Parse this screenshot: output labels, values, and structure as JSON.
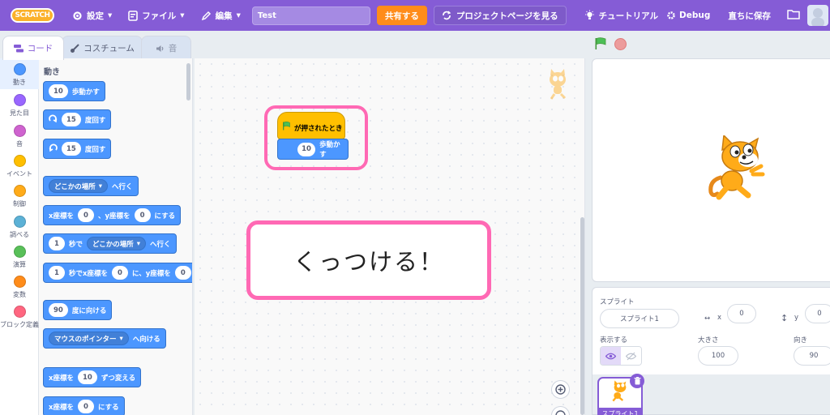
{
  "menubar": {
    "logo": "SCRATCH",
    "settings": "設定",
    "file": "ファイル",
    "edit": "編集",
    "project_title": "Test",
    "share": "共有する",
    "project_page": "プロジェクトページを見る",
    "tutorials": "チュートリアル",
    "debug": "Debug",
    "save_now": "直ちに保存"
  },
  "tabs": {
    "code": "コード",
    "costume": "コスチューム",
    "sound": "音"
  },
  "categories": [
    {
      "label": "動き",
      "color": "#4c97ff"
    },
    {
      "label": "見た目",
      "color": "#9966ff"
    },
    {
      "label": "音",
      "color": "#cf63cf"
    },
    {
      "label": "イベント",
      "color": "#ffbf00"
    },
    {
      "label": "制御",
      "color": "#ffab19"
    },
    {
      "label": "調べる",
      "color": "#5cb1d6"
    },
    {
      "label": "演算",
      "color": "#59c059"
    },
    {
      "label": "変数",
      "color": "#ff8c1a"
    },
    {
      "label": "ブロック定義",
      "color": "#ff6680"
    }
  ],
  "palette": {
    "section": "動き",
    "move": {
      "value": "10",
      "text": "歩動かす"
    },
    "turn_right": {
      "value": "15",
      "text": "度回す"
    },
    "turn_left": {
      "value": "15",
      "text": "度回す"
    },
    "goto": {
      "dropdown": "どこかの場所",
      "text": "へ行く"
    },
    "goto_xy": {
      "pre": "x座標を",
      "x": "0",
      "mid": "、y座標を",
      "y": "0",
      "post": "にする"
    },
    "glide": {
      "value": "1",
      "pre": "秒で",
      "dropdown": "どこかの場所",
      "post": "へ行く"
    },
    "glide_xy": {
      "value": "1",
      "pre": "秒でx座標を",
      "x": "0",
      "mid": "に、y座標を",
      "y": "0"
    },
    "point_dir": {
      "value": "90",
      "text": "度に向ける"
    },
    "point_towards": {
      "dropdown": "マウスのポインター",
      "text": "へ向ける"
    },
    "change_x": {
      "pre": "x座標を",
      "value": "10",
      "post": "ずつ変える"
    },
    "set_x": {
      "pre": "x座標を",
      "value": "0",
      "post": "にする"
    }
  },
  "workspace": {
    "hat_text": "が押されたとき",
    "move_value": "10",
    "move_text": "歩動かす",
    "callout": "くっつける！"
  },
  "sprite": {
    "label_sprite": "スプライト",
    "name": "スプライト1",
    "x_label": "x",
    "x": "0",
    "y_label": "y",
    "y": "0",
    "show_label": "表示する",
    "size_label": "大きさ",
    "size": "100",
    "direction_label": "向き",
    "direction": "90",
    "thumb_name": "スプライト1"
  }
}
